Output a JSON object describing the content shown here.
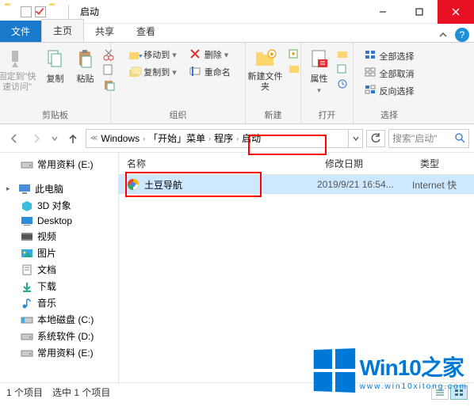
{
  "window": {
    "title": "启动",
    "controls": {
      "min": "—",
      "max": "☐",
      "close": "✕"
    }
  },
  "tabs": {
    "file": "文件",
    "home": "主页",
    "share": "共享",
    "view": "查看"
  },
  "ribbon": {
    "clipboard": {
      "pin": "固定到\"快速访问\"",
      "copy": "复制",
      "paste": "粘贴",
      "label": "剪贴板"
    },
    "organize": {
      "moveTo": "移动到",
      "copyTo": "复制到",
      "delete": "删除",
      "rename": "重命名",
      "label": "组织"
    },
    "new": {
      "newFolder": "新建文件夹",
      "label": "新建"
    },
    "open": {
      "properties": "属性",
      "label": "打开"
    },
    "select": {
      "selectAll": "全部选择",
      "selectNone": "全部取消",
      "invert": "反向选择",
      "label": "选择"
    }
  },
  "breadcrumb": {
    "items": [
      "Windows",
      "「开始」菜单",
      "程序",
      "启动"
    ]
  },
  "search": {
    "placeholder": "搜索\"启动\""
  },
  "sidebar": {
    "items": [
      {
        "label": "常用资料 (E:)",
        "icon": "drive"
      },
      {
        "label": "此电脑",
        "icon": "pc",
        "expandable": true
      },
      {
        "label": "3D 对象",
        "icon": "3d",
        "indent": true
      },
      {
        "label": "Desktop",
        "icon": "desktop",
        "indent": true
      },
      {
        "label": "视频",
        "icon": "video",
        "indent": true
      },
      {
        "label": "图片",
        "icon": "pictures",
        "indent": true
      },
      {
        "label": "文档",
        "icon": "docs",
        "indent": true
      },
      {
        "label": "下载",
        "icon": "downloads",
        "indent": true
      },
      {
        "label": "音乐",
        "icon": "music",
        "indent": true
      },
      {
        "label": "本地磁盘 (C:)",
        "icon": "drive-c",
        "indent": true
      },
      {
        "label": "系统软件 (D:)",
        "icon": "drive",
        "indent": true
      },
      {
        "label": "常用资料 (E:)",
        "icon": "drive",
        "indent": true
      }
    ]
  },
  "columns": {
    "name": "名称",
    "date": "修改日期",
    "type": "类型"
  },
  "files": [
    {
      "name": "土豆导航",
      "date": "2019/9/21 16:54...",
      "type": "Internet 快"
    }
  ],
  "status": {
    "count": "1 个项目",
    "selected": "选中 1 个项目"
  },
  "watermark": {
    "title1": "Win10",
    "title2": "之家",
    "sub": "www.win10xitong.com"
  }
}
